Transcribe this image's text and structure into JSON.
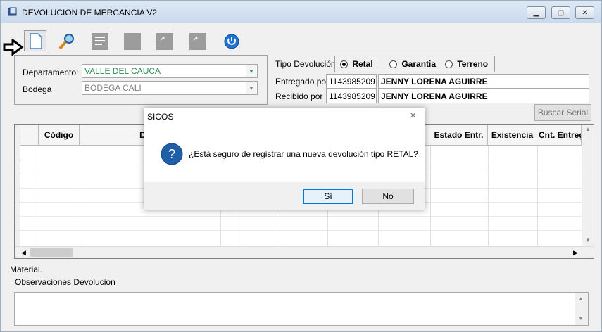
{
  "window": {
    "title": "DEVOLUCION DE MERCANCIA V2"
  },
  "form": {
    "departamento_label": "Departamento:",
    "departamento_value": "VALLE DEL CAUCA",
    "bodega_label": "Bodega",
    "bodega_value": "BODEGA CALI",
    "tipo_label": "Tipo Devolución",
    "tipo_options": [
      "Retal",
      "Garantia",
      "Terreno"
    ],
    "tipo_selected": "Retal",
    "entregado_label": "Entregado por",
    "entregado_id": "1143985209",
    "entregado_name": "JENNY LORENA AGUIRRE",
    "recibido_label": "Recibido por",
    "recibido_id": "1143985209",
    "recibido_name": "JENNY LORENA AGUIRRE",
    "buscar_serial": "Buscar Serial"
  },
  "grid": {
    "columns": [
      "Código",
      "Desc",
      "Estado Entr.",
      "Existencia",
      "Cnt. Entreg"
    ]
  },
  "footer": {
    "material_label": "Material.",
    "observaciones_label": "Observaciones Devolucion"
  },
  "dialog": {
    "title": "SICOS",
    "message": "¿Está seguro de registrar una nueva devolución tipo RETAL?",
    "yes": "Sí",
    "no": "No"
  },
  "icons": [
    "app-icon",
    "new-document-icon",
    "search-icon",
    "list-icon",
    "blank-icon",
    "save-icon",
    "print-icon",
    "power-icon",
    "pointer-arrow-icon",
    "question-icon"
  ],
  "colors": {
    "combo_text": "#2e8b57",
    "accent_blue": "#0a64c8",
    "title_gradient": "#c9d9ec"
  }
}
